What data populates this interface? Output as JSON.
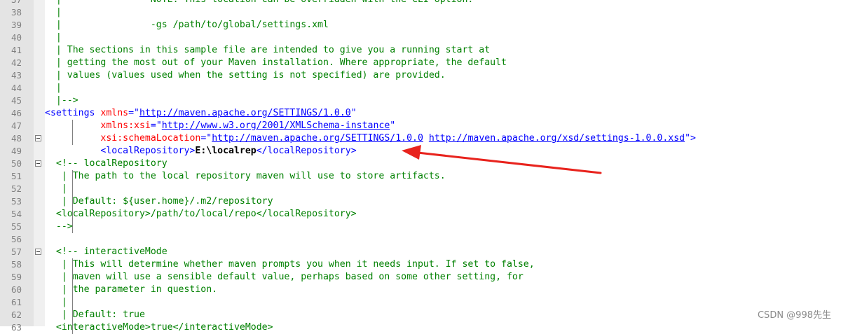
{
  "editor": {
    "lines": [
      {
        "num": "37",
        "segs": [
          {
            "cls": "c",
            "text": "  |                NOTE: This location can be overridden with the CLI option."
          }
        ]
      },
      {
        "num": "38",
        "segs": [
          {
            "cls": "c",
            "text": "  |"
          }
        ]
      },
      {
        "num": "39",
        "segs": [
          {
            "cls": "c",
            "text": "  |                -gs /path/to/global/settings.xml"
          }
        ]
      },
      {
        "num": "40",
        "segs": [
          {
            "cls": "c",
            "text": "  |"
          }
        ]
      },
      {
        "num": "41",
        "segs": [
          {
            "cls": "c",
            "text": "  | The sections in this sample file are intended to give you a running start at"
          }
        ]
      },
      {
        "num": "42",
        "segs": [
          {
            "cls": "c",
            "text": "  | getting the most out of your Maven installation. Where appropriate, the default"
          }
        ]
      },
      {
        "num": "43",
        "segs": [
          {
            "cls": "c",
            "text": "  | values (values used when the setting is not specified) are provided."
          }
        ]
      },
      {
        "num": "44",
        "segs": [
          {
            "cls": "c",
            "text": "  |"
          }
        ]
      },
      {
        "num": "45",
        "segs": [
          {
            "cls": "c",
            "text": "  |-->"
          }
        ]
      },
      {
        "num": "46",
        "segs": [
          {
            "cls": "t",
            "text": "<settings "
          },
          {
            "cls": "a",
            "text": "xmlns"
          },
          {
            "cls": "t",
            "text": "=\""
          },
          {
            "cls": "u",
            "text": "http://maven.apache.org/SETTINGS/1.0.0"
          },
          {
            "cls": "t",
            "text": "\""
          }
        ]
      },
      {
        "num": "47",
        "segs": [
          {
            "cls": "t",
            "text": "          "
          },
          {
            "cls": "a",
            "text": "xmlns:xsi"
          },
          {
            "cls": "t",
            "text": "=\""
          },
          {
            "cls": "u",
            "text": "http://www.w3.org/2001/XMLSchema-instance"
          },
          {
            "cls": "t",
            "text": "\""
          }
        ]
      },
      {
        "num": "48",
        "fold": true,
        "segs": [
          {
            "cls": "t",
            "text": "          "
          },
          {
            "cls": "a",
            "text": "xsi:schemaLocation"
          },
          {
            "cls": "t",
            "text": "=\""
          },
          {
            "cls": "u",
            "text": "http://maven.apache.org/SETTINGS/1.0.0"
          },
          {
            "cls": "t",
            "text": " "
          },
          {
            "cls": "u",
            "text": "http://maven.apache.org/xsd/settings-1.0.0.xsd"
          },
          {
            "cls": "t",
            "text": "\">"
          }
        ]
      },
      {
        "num": "49",
        "segs": [
          {
            "cls": "t",
            "text": "          <localRepository>"
          },
          {
            "cls": "x",
            "text": "E:\\localrep"
          },
          {
            "cls": "t",
            "text": "</localRepository>"
          }
        ]
      },
      {
        "num": "50",
        "fold": true,
        "segs": [
          {
            "cls": "c",
            "text": "  <!-- localRepository"
          }
        ]
      },
      {
        "num": "51",
        "segs": [
          {
            "cls": "c",
            "text": "   | The path to the local repository maven will use to store artifacts."
          }
        ]
      },
      {
        "num": "52",
        "segs": [
          {
            "cls": "c",
            "text": "   |"
          }
        ]
      },
      {
        "num": "53",
        "segs": [
          {
            "cls": "c",
            "text": "   | Default: ${user.home}/.m2/repository"
          }
        ]
      },
      {
        "num": "54",
        "segs": [
          {
            "cls": "c",
            "text": "  <localRepository>/path/to/local/repo</localRepository>"
          }
        ]
      },
      {
        "num": "55",
        "segs": [
          {
            "cls": "c",
            "text": "  -->"
          }
        ]
      },
      {
        "num": "56",
        "segs": [
          {
            "cls": "c",
            "text": ""
          }
        ]
      },
      {
        "num": "57",
        "fold": true,
        "segs": [
          {
            "cls": "c",
            "text": "  <!-- interactiveMode"
          }
        ]
      },
      {
        "num": "58",
        "segs": [
          {
            "cls": "c",
            "text": "   | This will determine whether maven prompts you when it needs input. If set to false,"
          }
        ]
      },
      {
        "num": "59",
        "segs": [
          {
            "cls": "c",
            "text": "   | maven will use a sensible default value, perhaps based on some other setting, for"
          }
        ]
      },
      {
        "num": "60",
        "segs": [
          {
            "cls": "c",
            "text": "   | the parameter in question."
          }
        ]
      },
      {
        "num": "61",
        "segs": [
          {
            "cls": "c",
            "text": "   |"
          }
        ]
      },
      {
        "num": "62",
        "segs": [
          {
            "cls": "c",
            "text": "   | Default: true"
          }
        ]
      },
      {
        "num": "63",
        "segs": [
          {
            "cls": "c",
            "text": "  <interactiveMode>true</interactiveMode>"
          }
        ]
      }
    ]
  },
  "colors": {
    "comment": "#008000",
    "tag": "#0000ff",
    "attribute": "#ff0000",
    "url": "#8000ff",
    "arrow": "#e8231d",
    "gutter": "#e4e4e4"
  },
  "annotation": {
    "arrow_icon": "red-arrow-icon"
  },
  "watermark": {
    "text": "CSDN @998先生"
  }
}
